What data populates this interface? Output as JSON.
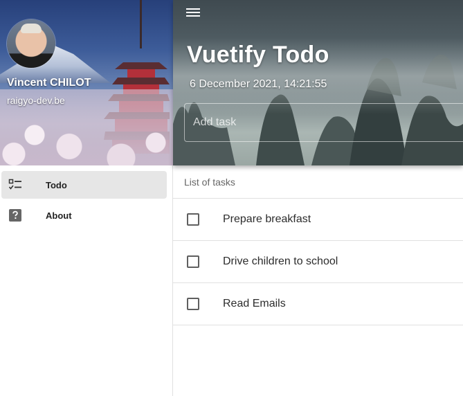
{
  "sidebar": {
    "user": {
      "name": "Vincent CHILOT",
      "email": "raigyo-dev.be"
    },
    "items": [
      {
        "label": "Todo",
        "icon": "checklist-icon",
        "active": true
      },
      {
        "label": "About",
        "icon": "help-box-icon",
        "active": false
      }
    ]
  },
  "header": {
    "menu_icon": "menu-icon",
    "title": "Vuetify Todo",
    "datetime": "6 December 2021, 14:21:55",
    "add_task_placeholder": "Add task"
  },
  "main": {
    "list_subheader": "List of tasks",
    "tasks": [
      {
        "title": "Prepare breakfast",
        "done": false
      },
      {
        "title": "Drive children to school",
        "done": false
      },
      {
        "title": "Read Emails",
        "done": false
      }
    ]
  },
  "colors": {
    "active_nav_bg": "#e6e6e6",
    "divider": "#e0e0e0",
    "text": "#212121"
  }
}
